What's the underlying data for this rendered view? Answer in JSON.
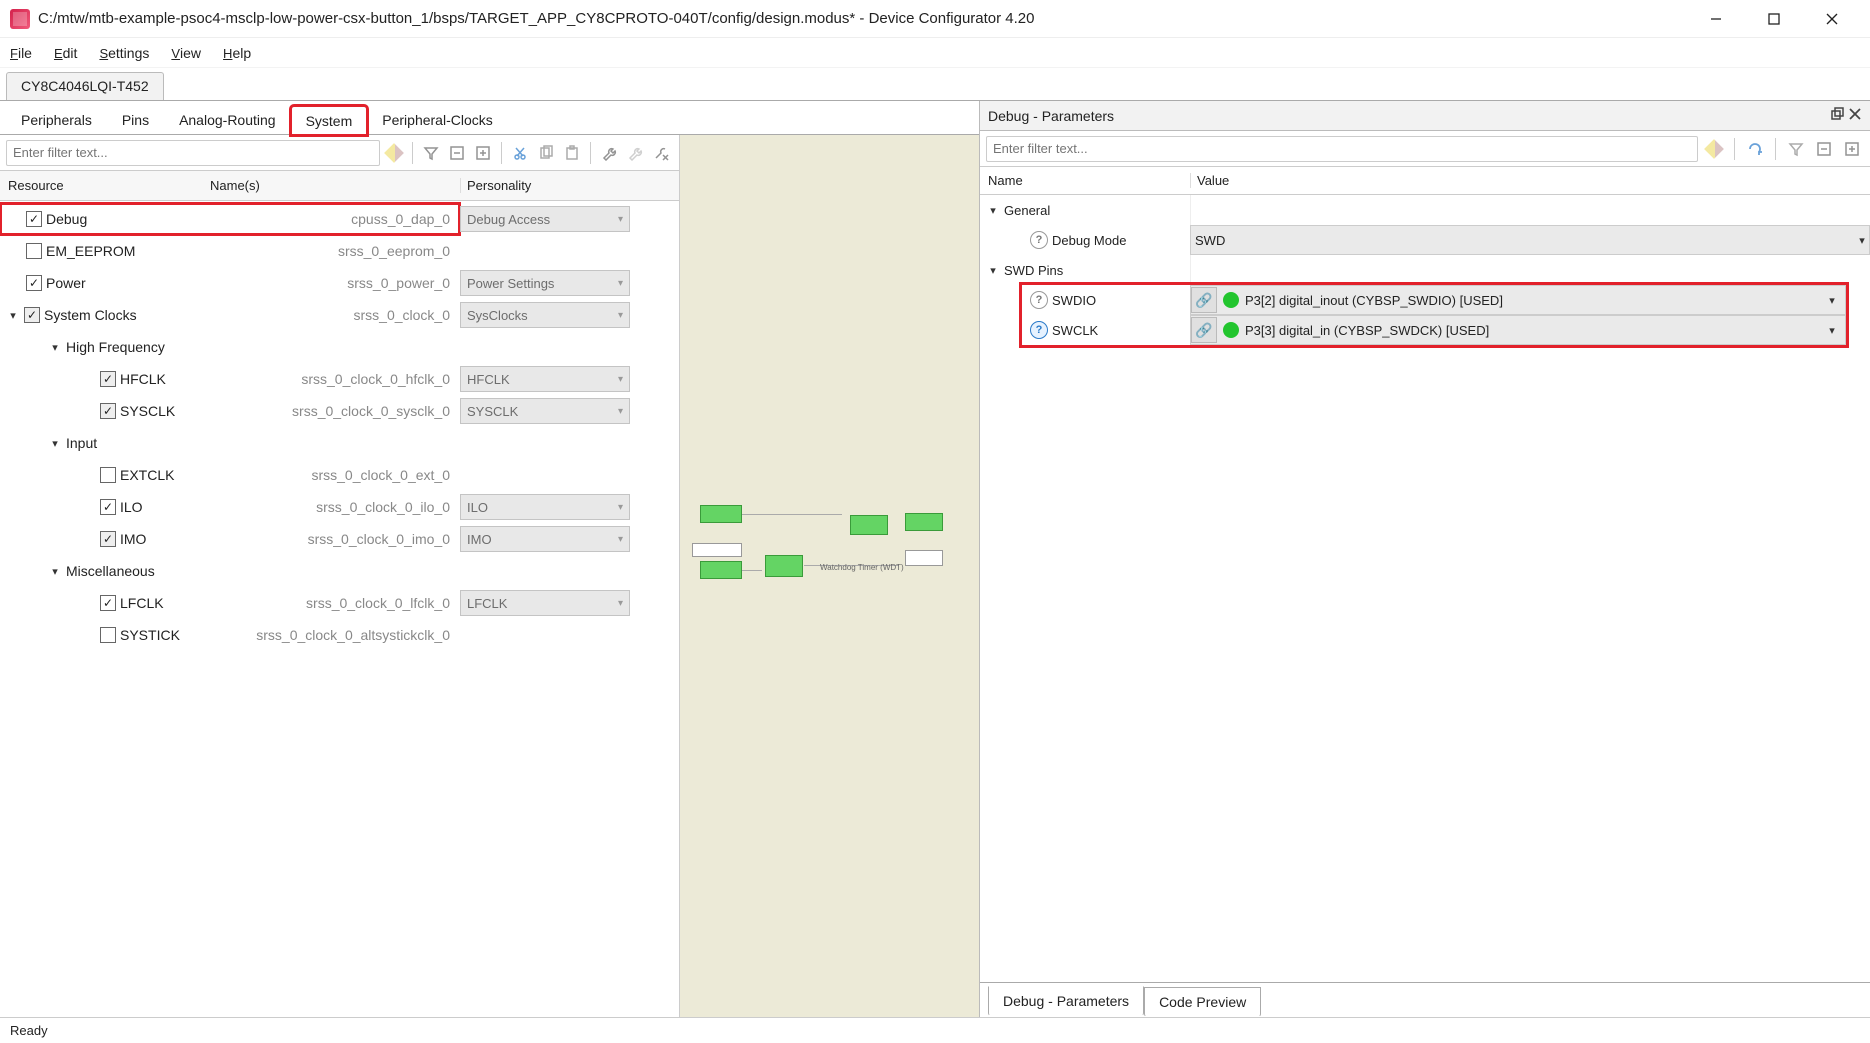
{
  "window": {
    "title": "C:/mtw/mtb-example-psoc4-msclp-low-power-csx-button_1/bsps/TARGET_APP_CY8CPROTO-040T/config/design.modus* - Device Configurator 4.20"
  },
  "menu": {
    "file": "File",
    "edit": "Edit",
    "settings": "Settings",
    "view": "View",
    "help": "Help"
  },
  "device_tab": "CY8C4046LQI-T452",
  "main_tabs": {
    "peripherals": "Peripherals",
    "pins": "Pins",
    "analog": "Analog-Routing",
    "system": "System",
    "pclk": "Peripheral-Clocks"
  },
  "left": {
    "filter_placeholder": "Enter filter text...",
    "headers": {
      "resource": "Resource",
      "names": "Name(s)",
      "personality": "Personality"
    },
    "rows": {
      "debug": {
        "label": "Debug",
        "name": "cpuss_0_dap_0",
        "pers": "Debug Access"
      },
      "eeprom": {
        "label": "EM_EEPROM",
        "name": "srss_0_eeprom_0"
      },
      "power": {
        "label": "Power",
        "name": "srss_0_power_0",
        "pers": "Power Settings"
      },
      "sysclocks": {
        "label": "System Clocks",
        "name": "srss_0_clock_0",
        "pers": "SysClocks"
      },
      "hf_group": "High Frequency",
      "hfclk": {
        "label": "HFCLK",
        "name": "srss_0_clock_0_hfclk_0",
        "pers": "HFCLK"
      },
      "sysclk": {
        "label": "SYSCLK",
        "name": "srss_0_clock_0_sysclk_0",
        "pers": "SYSCLK"
      },
      "input_group": "Input",
      "extclk": {
        "label": "EXTCLK",
        "name": "srss_0_clock_0_ext_0"
      },
      "ilo": {
        "label": "ILO",
        "name": "srss_0_clock_0_ilo_0",
        "pers": "ILO"
      },
      "imo": {
        "label": "IMO",
        "name": "srss_0_clock_0_imo_0",
        "pers": "IMO"
      },
      "misc_group": "Miscellaneous",
      "lfclk": {
        "label": "LFCLK",
        "name": "srss_0_clock_0_lfclk_0",
        "pers": "LFCLK"
      },
      "systick": {
        "label": "SYSTICK",
        "name": "srss_0_clock_0_altsystickclk_0"
      }
    }
  },
  "right": {
    "panel_title": "Debug - Parameters",
    "filter_placeholder": "Enter filter text...",
    "headers": {
      "name": "Name",
      "value": "Value"
    },
    "general": "General",
    "debug_mode_label": "Debug Mode",
    "debug_mode_value": "SWD",
    "swd_pins": "SWD Pins",
    "swdio": {
      "label": "SWDIO",
      "value": "P3[2] digital_inout (CYBSP_SWDIO) [USED]"
    },
    "swclk": {
      "label": "SWCLK",
      "value": "P3[3] digital_in (CYBSP_SWDCK) [USED]"
    }
  },
  "bottom_tabs": {
    "params": "Debug - Parameters",
    "preview": "Code Preview"
  },
  "status": "Ready"
}
